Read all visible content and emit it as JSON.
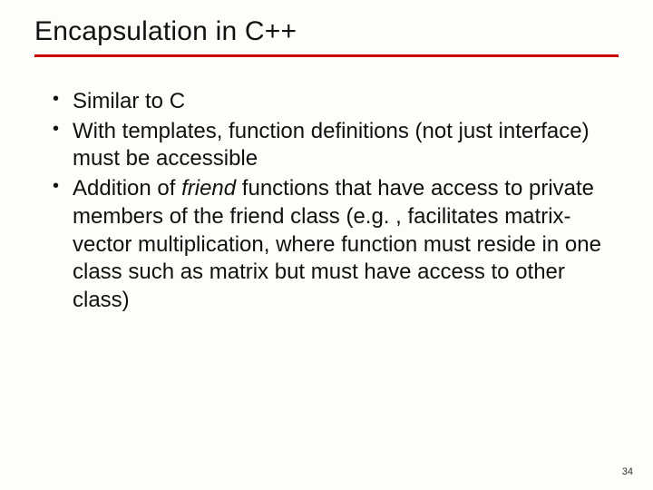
{
  "slide": {
    "title": "Encapsulation in C++",
    "bullets": {
      "b1": "Similar to C",
      "b2": "With templates, function definitions (not just interface) must be accessible",
      "b3_pre": "Addition of ",
      "b3_em": "friend",
      "b3_post": " functions that have access to private members of the friend class (e.g. , facilitates matrix-vector multiplication, where function must reside in one class such as matrix but must have access to other class)"
    },
    "page_number": "34"
  }
}
